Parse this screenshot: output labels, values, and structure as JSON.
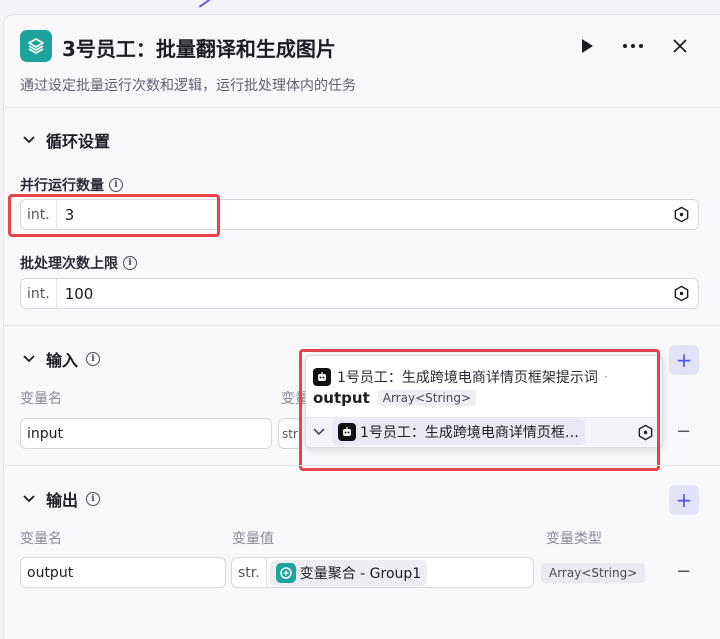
{
  "header": {
    "title": "3号员工：批量翻译和生成图片",
    "description": "通过设定批量运行次数和逻辑，运行批处理体内的任务"
  },
  "loop_settings": {
    "title": "循环设置",
    "parallel_label": "并行运行数量",
    "parallel_prefix": "int.",
    "parallel_value": "3",
    "batch_label": "批处理次数上限",
    "batch_prefix": "int.",
    "batch_value": "100"
  },
  "input_section": {
    "title": "输入",
    "col_var_name": "变量名",
    "col_var_value_partial": "变量",
    "row": {
      "name": "input",
      "prefix_partial": "str",
      "value_chip": "1号员工：生成跨境电商详情页框…"
    }
  },
  "popup": {
    "source": "1号员工：生成跨境电商详情页框架提示词",
    "output_name": "output",
    "output_type": "Array<String>"
  },
  "output_section": {
    "title": "输出",
    "col_var_name": "变量名",
    "col_var_value": "变量值",
    "col_var_type": "变量类型",
    "row": {
      "name": "output",
      "prefix": "str.",
      "value_label": "变量聚合 - Group1",
      "type": "Array<String>"
    }
  },
  "colors": {
    "accent": "#4d53e8",
    "node_icon": "#1ba39c",
    "highlight": "#e8424a"
  }
}
